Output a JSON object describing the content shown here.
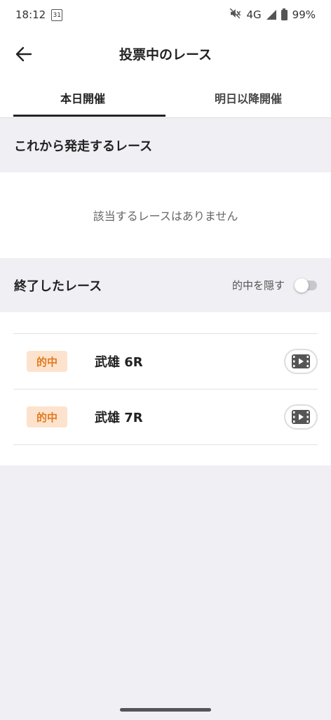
{
  "status_bar": {
    "time": "18:12",
    "calendar_day": "31",
    "network": "4G",
    "battery": "99%"
  },
  "header": {
    "title": "投票中のレース",
    "tabs": [
      {
        "label": "本日開催",
        "active": true
      },
      {
        "label": "明日以降開催",
        "active": false
      }
    ]
  },
  "upcoming": {
    "title": "これから発走するレース",
    "empty_text": "該当するレースはありません"
  },
  "finished": {
    "title": "終了したレース",
    "hide_toggle_label": "的中を隠す",
    "hide_toggle_on": false,
    "races": [
      {
        "badge": "的中",
        "name": "武雄 6R"
      },
      {
        "badge": "的中",
        "name": "武雄 7R"
      }
    ]
  }
}
